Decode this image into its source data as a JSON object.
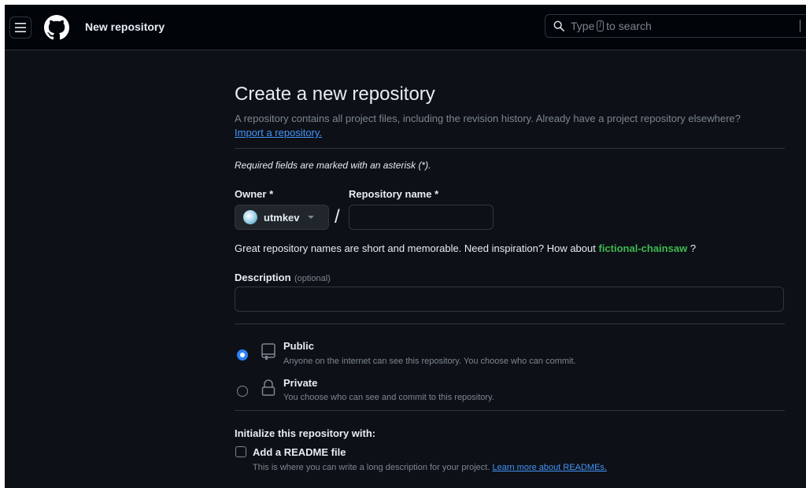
{
  "header": {
    "title": "New repository",
    "search_placeholder_before": "Type",
    "search_key": "/",
    "search_placeholder_after": "to search"
  },
  "main": {
    "heading": "Create a new repository",
    "subtitle": "A repository contains all project files, including the revision history. Already have a project repository elsewhere?",
    "import_link": "Import a repository.",
    "required_note": "Required fields are marked with an asterisk (*).",
    "owner_label": "Owner *",
    "owner_value": "utmkev",
    "slash": "/",
    "repo_name_label": "Repository name *",
    "repo_name_value": "",
    "hint_text": "Great repository names are short and memorable. Need inspiration? How about",
    "hint_suggestion": "fictional-chainsaw",
    "hint_end": "?",
    "description_label": "Description",
    "description_optional": "(optional)",
    "description_value": "",
    "visibility": {
      "selected": "Public",
      "options": [
        {
          "title": "Public",
          "desc": "Anyone on the internet can see this repository. You choose who can commit."
        },
        {
          "title": "Private",
          "desc": "You choose who can see and commit to this repository."
        }
      ]
    },
    "init_heading": "Initialize this repository with:",
    "readme_label": "Add a README file",
    "readme_checked": false,
    "readme_desc": "This is where you can write a long description for your project.",
    "readme_link": "Learn more about READMEs."
  },
  "icons": [
    "hamburger-icon",
    "github-logo-icon",
    "search-icon",
    "repo-icon",
    "lock-icon",
    "chevron-down-icon"
  ],
  "colors": {
    "background": "#0d1117",
    "header_background": "#010409",
    "border": "#30363d",
    "link": "#4493f8",
    "suggestion": "#3fb950",
    "radio_selected": "#2f81f7"
  }
}
